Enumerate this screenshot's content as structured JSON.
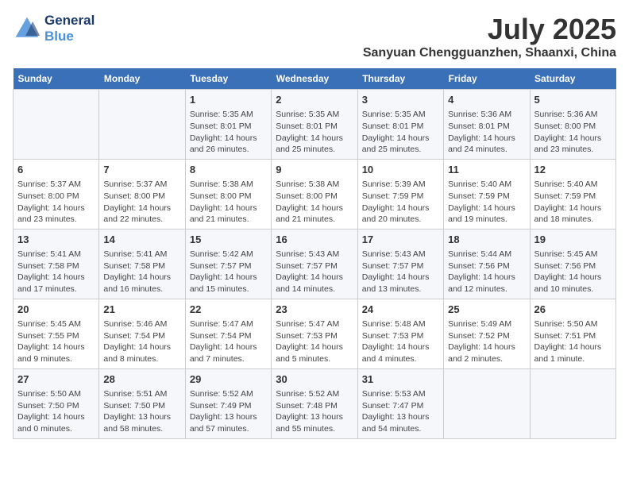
{
  "header": {
    "logo_line1": "General",
    "logo_line2": "Blue",
    "main_title": "July 2025",
    "sub_title": "Sanyuan Chengguanzhen, Shaanxi, China"
  },
  "day_headers": [
    "Sunday",
    "Monday",
    "Tuesday",
    "Wednesday",
    "Thursday",
    "Friday",
    "Saturday"
  ],
  "weeks": [
    [
      {
        "date": "",
        "content": ""
      },
      {
        "date": "",
        "content": ""
      },
      {
        "date": "1",
        "content": "Sunrise: 5:35 AM\nSunset: 8:01 PM\nDaylight: 14 hours and 26 minutes."
      },
      {
        "date": "2",
        "content": "Sunrise: 5:35 AM\nSunset: 8:01 PM\nDaylight: 14 hours and 25 minutes."
      },
      {
        "date": "3",
        "content": "Sunrise: 5:35 AM\nSunset: 8:01 PM\nDaylight: 14 hours and 25 minutes."
      },
      {
        "date": "4",
        "content": "Sunrise: 5:36 AM\nSunset: 8:01 PM\nDaylight: 14 hours and 24 minutes."
      },
      {
        "date": "5",
        "content": "Sunrise: 5:36 AM\nSunset: 8:00 PM\nDaylight: 14 hours and 23 minutes."
      }
    ],
    [
      {
        "date": "6",
        "content": "Sunrise: 5:37 AM\nSunset: 8:00 PM\nDaylight: 14 hours and 23 minutes."
      },
      {
        "date": "7",
        "content": "Sunrise: 5:37 AM\nSunset: 8:00 PM\nDaylight: 14 hours and 22 minutes."
      },
      {
        "date": "8",
        "content": "Sunrise: 5:38 AM\nSunset: 8:00 PM\nDaylight: 14 hours and 21 minutes."
      },
      {
        "date": "9",
        "content": "Sunrise: 5:38 AM\nSunset: 8:00 PM\nDaylight: 14 hours and 21 minutes."
      },
      {
        "date": "10",
        "content": "Sunrise: 5:39 AM\nSunset: 7:59 PM\nDaylight: 14 hours and 20 minutes."
      },
      {
        "date": "11",
        "content": "Sunrise: 5:40 AM\nSunset: 7:59 PM\nDaylight: 14 hours and 19 minutes."
      },
      {
        "date": "12",
        "content": "Sunrise: 5:40 AM\nSunset: 7:59 PM\nDaylight: 14 hours and 18 minutes."
      }
    ],
    [
      {
        "date": "13",
        "content": "Sunrise: 5:41 AM\nSunset: 7:58 PM\nDaylight: 14 hours and 17 minutes."
      },
      {
        "date": "14",
        "content": "Sunrise: 5:41 AM\nSunset: 7:58 PM\nDaylight: 14 hours and 16 minutes."
      },
      {
        "date": "15",
        "content": "Sunrise: 5:42 AM\nSunset: 7:57 PM\nDaylight: 14 hours and 15 minutes."
      },
      {
        "date": "16",
        "content": "Sunrise: 5:43 AM\nSunset: 7:57 PM\nDaylight: 14 hours and 14 minutes."
      },
      {
        "date": "17",
        "content": "Sunrise: 5:43 AM\nSunset: 7:57 PM\nDaylight: 14 hours and 13 minutes."
      },
      {
        "date": "18",
        "content": "Sunrise: 5:44 AM\nSunset: 7:56 PM\nDaylight: 14 hours and 12 minutes."
      },
      {
        "date": "19",
        "content": "Sunrise: 5:45 AM\nSunset: 7:56 PM\nDaylight: 14 hours and 10 minutes."
      }
    ],
    [
      {
        "date": "20",
        "content": "Sunrise: 5:45 AM\nSunset: 7:55 PM\nDaylight: 14 hours and 9 minutes."
      },
      {
        "date": "21",
        "content": "Sunrise: 5:46 AM\nSunset: 7:54 PM\nDaylight: 14 hours and 8 minutes."
      },
      {
        "date": "22",
        "content": "Sunrise: 5:47 AM\nSunset: 7:54 PM\nDaylight: 14 hours and 7 minutes."
      },
      {
        "date": "23",
        "content": "Sunrise: 5:47 AM\nSunset: 7:53 PM\nDaylight: 14 hours and 5 minutes."
      },
      {
        "date": "24",
        "content": "Sunrise: 5:48 AM\nSunset: 7:53 PM\nDaylight: 14 hours and 4 minutes."
      },
      {
        "date": "25",
        "content": "Sunrise: 5:49 AM\nSunset: 7:52 PM\nDaylight: 14 hours and 2 minutes."
      },
      {
        "date": "26",
        "content": "Sunrise: 5:50 AM\nSunset: 7:51 PM\nDaylight: 14 hours and 1 minute."
      }
    ],
    [
      {
        "date": "27",
        "content": "Sunrise: 5:50 AM\nSunset: 7:50 PM\nDaylight: 14 hours and 0 minutes."
      },
      {
        "date": "28",
        "content": "Sunrise: 5:51 AM\nSunset: 7:50 PM\nDaylight: 13 hours and 58 minutes."
      },
      {
        "date": "29",
        "content": "Sunrise: 5:52 AM\nSunset: 7:49 PM\nDaylight: 13 hours and 57 minutes."
      },
      {
        "date": "30",
        "content": "Sunrise: 5:52 AM\nSunset: 7:48 PM\nDaylight: 13 hours and 55 minutes."
      },
      {
        "date": "31",
        "content": "Sunrise: 5:53 AM\nSunset: 7:47 PM\nDaylight: 13 hours and 54 minutes."
      },
      {
        "date": "",
        "content": ""
      },
      {
        "date": "",
        "content": ""
      }
    ]
  ]
}
